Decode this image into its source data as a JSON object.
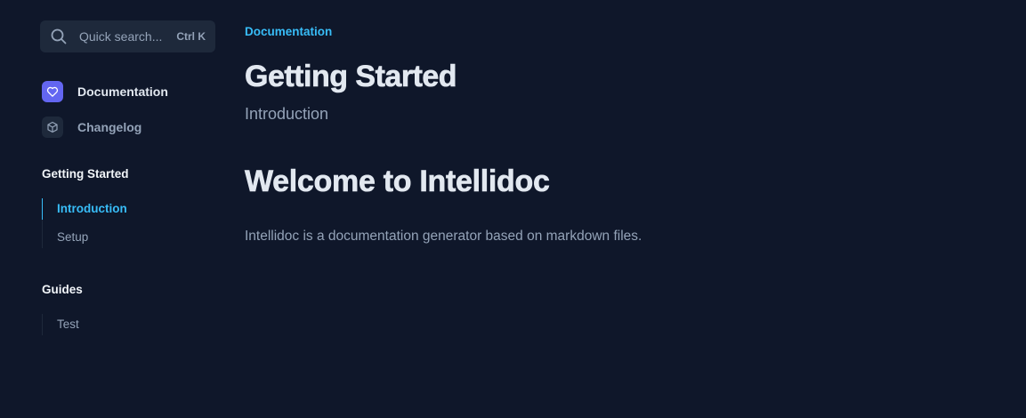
{
  "search": {
    "placeholder": "Quick search...",
    "shortcut": "Ctrl K",
    "icon": "search-icon"
  },
  "nav": {
    "top_links": [
      {
        "label": "Documentation",
        "icon": "heart-icon",
        "active": true,
        "accent": "#6366f1"
      },
      {
        "label": "Changelog",
        "icon": "cube-icon",
        "active": false
      }
    ],
    "sections": [
      {
        "title": "Getting Started",
        "items": [
          {
            "label": "Introduction",
            "active": true
          },
          {
            "label": "Setup",
            "active": false
          }
        ]
      },
      {
        "title": "Guides",
        "items": [
          {
            "label": "Test",
            "active": false
          }
        ]
      }
    ]
  },
  "main": {
    "breadcrumb": "Documentation",
    "title": "Getting Started",
    "subtitle": "Introduction",
    "heading": "Welcome to Intellidoc",
    "paragraph": "Intellidoc is a documentation generator based on markdown files."
  },
  "colors": {
    "background": "#0f172a",
    "accent": "#38bdf8",
    "brand": "#6366f1"
  }
}
